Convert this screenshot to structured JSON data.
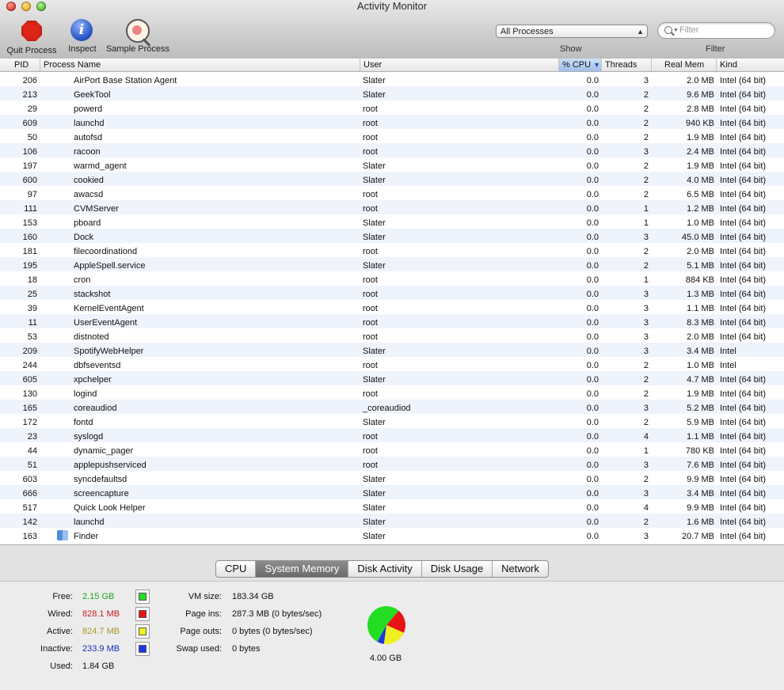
{
  "window": {
    "title": "Activity Monitor"
  },
  "toolbar": {
    "quit_label": "Quit Process",
    "inspect_label": "Inspect",
    "sample_label": "Sample Process",
    "show_selected": "All Processes",
    "show_label": "Show",
    "filter_placeholder": "Filter",
    "filter_label": "Filter"
  },
  "columns": {
    "pid": "PID",
    "name": "Process Name",
    "user": "User",
    "cpu": "% CPU",
    "threads": "Threads",
    "mem": "Real Mem",
    "kind": "Kind"
  },
  "processes": [
    {
      "pid": "206",
      "name": "AirPort Base Station Agent",
      "user": "Slater",
      "cpu": "0.0",
      "threads": "3",
      "mem": "2.0 MB",
      "kind": "Intel (64 bit)"
    },
    {
      "pid": "213",
      "name": "GeekTool",
      "user": "Slater",
      "cpu": "0.0",
      "threads": "2",
      "mem": "9.6 MB",
      "kind": "Intel (64 bit)"
    },
    {
      "pid": "29",
      "name": "powerd",
      "user": "root",
      "cpu": "0.0",
      "threads": "2",
      "mem": "2.8 MB",
      "kind": "Intel (64 bit)"
    },
    {
      "pid": "609",
      "name": "launchd",
      "user": "root",
      "cpu": "0.0",
      "threads": "2",
      "mem": "940 KB",
      "kind": "Intel (64 bit)"
    },
    {
      "pid": "50",
      "name": "autofsd",
      "user": "root",
      "cpu": "0.0",
      "threads": "2",
      "mem": "1.9 MB",
      "kind": "Intel (64 bit)"
    },
    {
      "pid": "106",
      "name": "racoon",
      "user": "root",
      "cpu": "0.0",
      "threads": "3",
      "mem": "2.4 MB",
      "kind": "Intel (64 bit)"
    },
    {
      "pid": "197",
      "name": "warmd_agent",
      "user": "Slater",
      "cpu": "0.0",
      "threads": "2",
      "mem": "1.9 MB",
      "kind": "Intel (64 bit)"
    },
    {
      "pid": "600",
      "name": "cookied",
      "user": "Slater",
      "cpu": "0.0",
      "threads": "2",
      "mem": "4.0 MB",
      "kind": "Intel (64 bit)"
    },
    {
      "pid": "97",
      "name": "awacsd",
      "user": "root",
      "cpu": "0.0",
      "threads": "2",
      "mem": "6.5 MB",
      "kind": "Intel (64 bit)"
    },
    {
      "pid": "111",
      "name": "CVMServer",
      "user": "root",
      "cpu": "0.0",
      "threads": "1",
      "mem": "1.2 MB",
      "kind": "Intel (64 bit)"
    },
    {
      "pid": "153",
      "name": "pboard",
      "user": "Slater",
      "cpu": "0.0",
      "threads": "1",
      "mem": "1.0 MB",
      "kind": "Intel (64 bit)"
    },
    {
      "pid": "160",
      "name": "Dock",
      "user": "Slater",
      "cpu": "0.0",
      "threads": "3",
      "mem": "45.0 MB",
      "kind": "Intel (64 bit)"
    },
    {
      "pid": "181",
      "name": "filecoordinationd",
      "user": "root",
      "cpu": "0.0",
      "threads": "2",
      "mem": "2.0 MB",
      "kind": "Intel (64 bit)"
    },
    {
      "pid": "195",
      "name": "AppleSpell.service",
      "user": "Slater",
      "cpu": "0.0",
      "threads": "2",
      "mem": "5.1 MB",
      "kind": "Intel (64 bit)"
    },
    {
      "pid": "18",
      "name": "cron",
      "user": "root",
      "cpu": "0.0",
      "threads": "1",
      "mem": "884 KB",
      "kind": "Intel (64 bit)"
    },
    {
      "pid": "25",
      "name": "stackshot",
      "user": "root",
      "cpu": "0.0",
      "threads": "3",
      "mem": "1.3 MB",
      "kind": "Intel (64 bit)"
    },
    {
      "pid": "39",
      "name": "KernelEventAgent",
      "user": "root",
      "cpu": "0.0",
      "threads": "3",
      "mem": "1.1 MB",
      "kind": "Intel (64 bit)"
    },
    {
      "pid": "11",
      "name": "UserEventAgent",
      "user": "root",
      "cpu": "0.0",
      "threads": "3",
      "mem": "8.3 MB",
      "kind": "Intel (64 bit)"
    },
    {
      "pid": "53",
      "name": "distnoted",
      "user": "root",
      "cpu": "0.0",
      "threads": "3",
      "mem": "2.0 MB",
      "kind": "Intel (64 bit)"
    },
    {
      "pid": "209",
      "name": "SpotifyWebHelper",
      "user": "Slater",
      "cpu": "0.0",
      "threads": "3",
      "mem": "3.4 MB",
      "kind": "Intel"
    },
    {
      "pid": "244",
      "name": "dbfseventsd",
      "user": "root",
      "cpu": "0.0",
      "threads": "2",
      "mem": "1.0 MB",
      "kind": "Intel"
    },
    {
      "pid": "605",
      "name": "xpchelper",
      "user": "Slater",
      "cpu": "0.0",
      "threads": "2",
      "mem": "4.7 MB",
      "kind": "Intel (64 bit)"
    },
    {
      "pid": "130",
      "name": "logind",
      "user": "root",
      "cpu": "0.0",
      "threads": "2",
      "mem": "1.9 MB",
      "kind": "Intel (64 bit)"
    },
    {
      "pid": "165",
      "name": "coreaudiod",
      "user": "_coreaudiod",
      "cpu": "0.0",
      "threads": "3",
      "mem": "5.2 MB",
      "kind": "Intel (64 bit)"
    },
    {
      "pid": "172",
      "name": "fontd",
      "user": "Slater",
      "cpu": "0.0",
      "threads": "2",
      "mem": "5.9 MB",
      "kind": "Intel (64 bit)"
    },
    {
      "pid": "23",
      "name": "syslogd",
      "user": "root",
      "cpu": "0.0",
      "threads": "4",
      "mem": "1.1 MB",
      "kind": "Intel (64 bit)"
    },
    {
      "pid": "44",
      "name": "dynamic_pager",
      "user": "root",
      "cpu": "0.0",
      "threads": "1",
      "mem": "780 KB",
      "kind": "Intel (64 bit)"
    },
    {
      "pid": "51",
      "name": "applepushserviced",
      "user": "root",
      "cpu": "0.0",
      "threads": "3",
      "mem": "7.6 MB",
      "kind": "Intel (64 bit)"
    },
    {
      "pid": "603",
      "name": "syncdefaultsd",
      "user": "Slater",
      "cpu": "0.0",
      "threads": "2",
      "mem": "9.9 MB",
      "kind": "Intel (64 bit)"
    },
    {
      "pid": "666",
      "name": "screencapture",
      "user": "Slater",
      "cpu": "0.0",
      "threads": "3",
      "mem": "3.4 MB",
      "kind": "Intel (64 bit)"
    },
    {
      "pid": "517",
      "name": "Quick Look Helper",
      "user": "Slater",
      "cpu": "0.0",
      "threads": "4",
      "mem": "9.9 MB",
      "kind": "Intel (64 bit)"
    },
    {
      "pid": "142",
      "name": "launchd",
      "user": "Slater",
      "cpu": "0.0",
      "threads": "2",
      "mem": "1.6 MB",
      "kind": "Intel (64 bit)"
    },
    {
      "pid": "163",
      "name": "Finder",
      "user": "Slater",
      "cpu": "0.0",
      "threads": "3",
      "mem": "20.7 MB",
      "kind": "Intel (64 bit)",
      "icon": "finder-icon"
    }
  ],
  "tabs": [
    {
      "label": "CPU"
    },
    {
      "label": "System Memory",
      "active": true
    },
    {
      "label": "Disk Activity"
    },
    {
      "label": "Disk Usage"
    },
    {
      "label": "Network"
    }
  ],
  "memory": {
    "free": {
      "label": "Free:",
      "value": "2.15 GB",
      "color": "#1fa51f",
      "swatch": "#22dd22"
    },
    "wired": {
      "label": "Wired:",
      "value": "828.1 MB",
      "color": "#c81e1e",
      "swatch": "#e61414"
    },
    "active": {
      "label": "Active:",
      "value": "824.7 MB",
      "color": "#a89a20",
      "swatch": "#f0f020"
    },
    "inactive": {
      "label": "Inactive:",
      "value": "233.9 MB",
      "color": "#1e2ab8",
      "swatch": "#1b35e6"
    },
    "used": {
      "label": "Used:",
      "value": "1.84 GB",
      "color": "#111111"
    },
    "vm_size": {
      "label": "VM size:",
      "value": "183.34 GB"
    },
    "page_ins": {
      "label": "Page ins:",
      "value": "287.3 MB (0 bytes/sec)"
    },
    "page_outs": {
      "label": "Page outs:",
      "value": "0 bytes (0 bytes/sec)"
    },
    "swap_used": {
      "label": "Swap used:",
      "value": "0 bytes"
    },
    "total": "4.00 GB"
  },
  "chart_data": {
    "type": "pie",
    "categories": [
      "Free",
      "Wired",
      "Active",
      "Inactive"
    ],
    "values": [
      2.15,
      0.8281,
      0.8247,
      0.2339
    ],
    "colors": [
      "#22dd22",
      "#e61414",
      "#f0f020",
      "#1b35e6"
    ]
  }
}
